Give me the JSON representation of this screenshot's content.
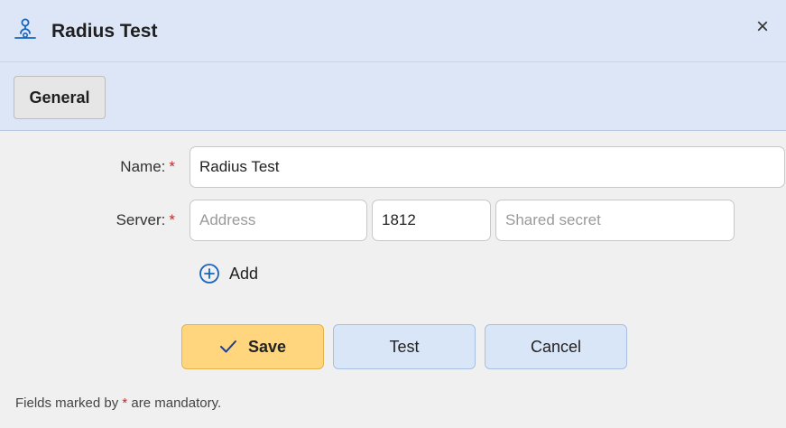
{
  "dialog": {
    "title": "Radius Test",
    "title_icon": "network-node-icon",
    "close_glyph": "×"
  },
  "tabs": [
    {
      "label": "General",
      "active": true
    }
  ],
  "form": {
    "name": {
      "label": "Name:",
      "required_marker": "*",
      "value": "Radius Test"
    },
    "server": {
      "label": "Server:",
      "required_marker": "*",
      "address": {
        "value": "",
        "placeholder": "Address"
      },
      "port": {
        "value": "1812"
      },
      "secret": {
        "value": "",
        "placeholder": "Shared secret"
      }
    },
    "add_label": "Add"
  },
  "buttons": {
    "save": "Save",
    "test": "Test",
    "cancel": "Cancel"
  },
  "footnote": {
    "before": "Fields marked by ",
    "marker": "*",
    "after": " are mandatory."
  },
  "colors": {
    "header_bg": "#dde6f6",
    "save_bg": "#ffd67e",
    "secondary_bg": "#d9e6f8",
    "required": "#c62828",
    "accent_icon": "#1565c0"
  }
}
